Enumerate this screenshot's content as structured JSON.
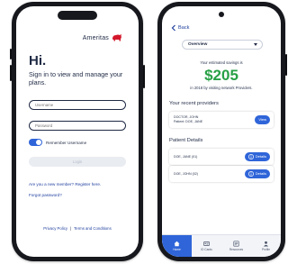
{
  "login_screen": {
    "brand": {
      "name": "Ameritas",
      "logo_icon": "bison-logo-icon",
      "logo_color": "#d3182b"
    },
    "greeting": "Hi.",
    "subtitle": "Sign in to view and manage your plans.",
    "username": {
      "placeholder": "Username",
      "value": ""
    },
    "password": {
      "placeholder": "Password",
      "value": ""
    },
    "remember": {
      "label": "Remember Username",
      "enabled": true
    },
    "login_button": {
      "label": "Login"
    },
    "register_link": "Are you a new member? Register here.",
    "forgot_link": "Forgot password?",
    "footer": {
      "privacy": "Privacy Policy",
      "separator": "|",
      "terms": "Terms and Conditions"
    }
  },
  "dashboard_screen": {
    "back_label": "Back",
    "view_select": {
      "selected": "Overview"
    },
    "savings": {
      "caption": "Your estimated savings is",
      "amount": "$205",
      "note": "in 2018 by visiting network Providers."
    },
    "providers_section": {
      "title": "Your recent providers",
      "items": [
        {
          "line1": "DOCTOR, JOHN",
          "line2": "Patient: DOE, JANE",
          "button": "View"
        }
      ]
    },
    "patients_section": {
      "title": "Patient Details",
      "items": [
        {
          "name": "DOE, JANE (01)",
          "button": "Details"
        },
        {
          "name": "DOE, JOHN (02)",
          "button": "Details"
        }
      ]
    },
    "tabs": [
      {
        "label": "Home",
        "icon": "home-icon",
        "active": true
      },
      {
        "label": "ID Cards",
        "icon": "id-card-icon",
        "active": false
      },
      {
        "label": "Resources",
        "icon": "resources-icon",
        "active": false
      },
      {
        "label": "Profile",
        "icon": "profile-icon",
        "active": false
      }
    ]
  },
  "colors": {
    "accent": "#2f65d9",
    "savings_green": "#27a046",
    "link_blue": "#1f3f9e",
    "text_navy": "#1f2a44",
    "phone_frame": "#16181d"
  }
}
